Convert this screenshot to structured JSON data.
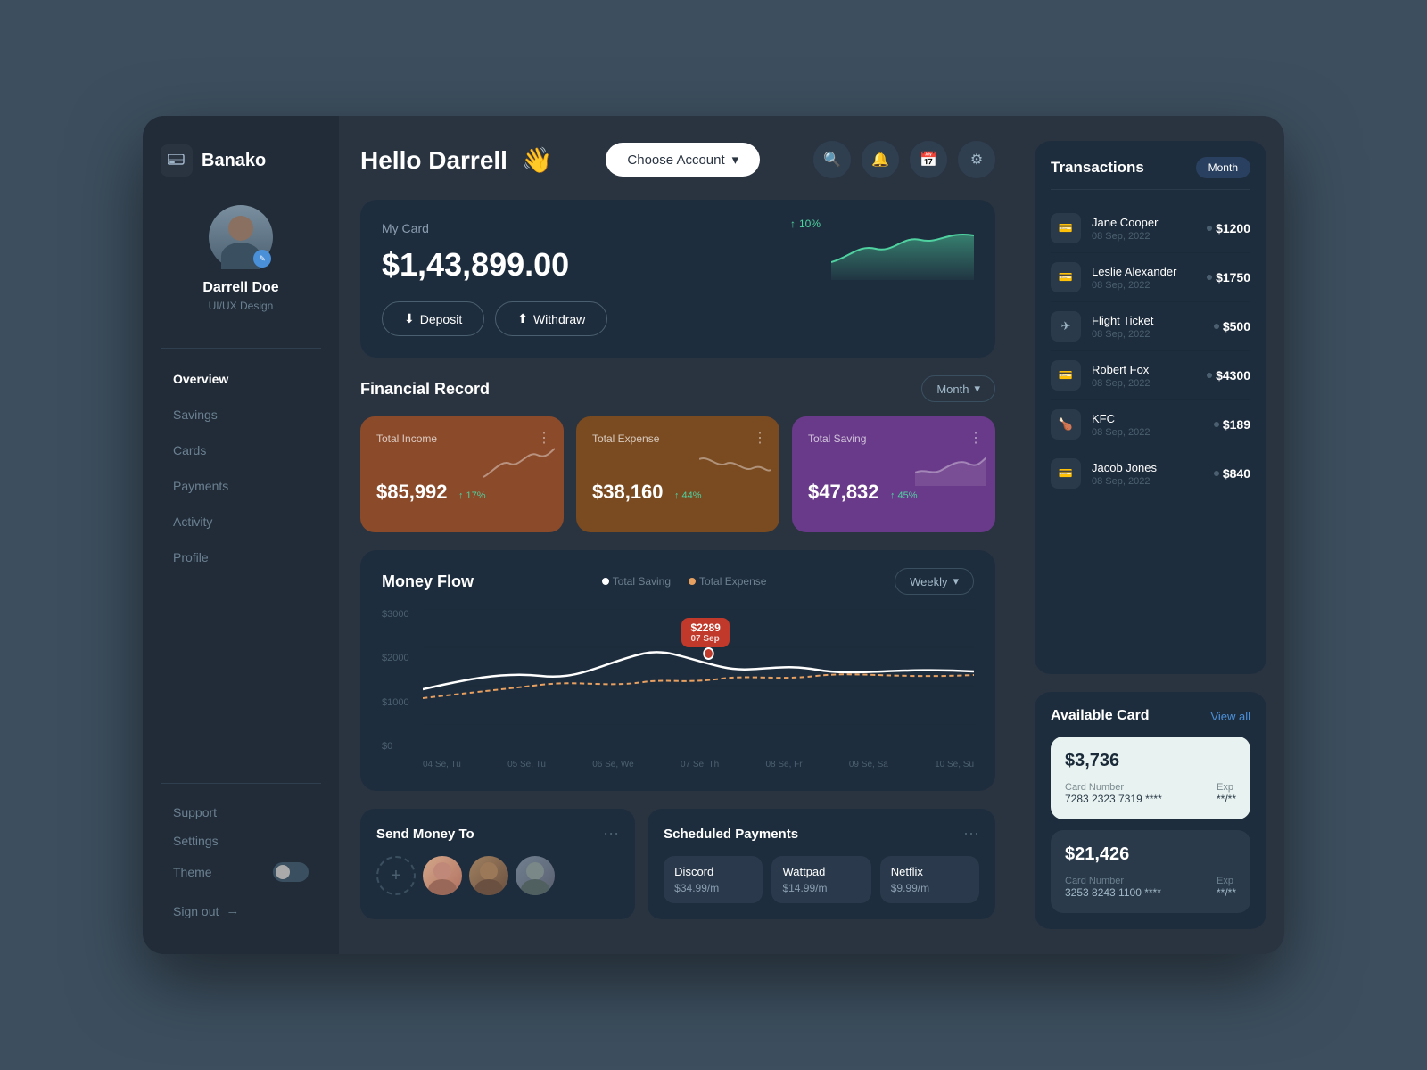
{
  "app": {
    "name": "Banako"
  },
  "user": {
    "name": "Darrell Doe",
    "role": "UI/UX Design",
    "greeting": "Hello Darrell",
    "wave": "👋"
  },
  "header": {
    "choose_account": "Choose Account",
    "actions": [
      "search",
      "bell",
      "calendar",
      "gear"
    ]
  },
  "my_card": {
    "title": "My Card",
    "balance": "$1,43,899.00",
    "trend_pct": "10%",
    "deposit_label": "Deposit",
    "withdraw_label": "Withdraw"
  },
  "financial_record": {
    "title": "Financial Record",
    "period_label": "Month",
    "income": {
      "label": "Total Income",
      "amount": "$85,992",
      "change": "↑ 17%"
    },
    "expense": {
      "label": "Total Expense",
      "amount": "$38,160",
      "change": "↑ 44%"
    },
    "saving": {
      "label": "Total Saving",
      "amount": "$47,832",
      "change": "↑ 45%"
    }
  },
  "money_flow": {
    "title": "Money Flow",
    "legend_saving": "Total Saving",
    "legend_expense": "Total Expense",
    "period_label": "Weekly",
    "tooltip_amount": "$2289",
    "tooltip_date": "07 Sep",
    "y_labels": [
      "$3000",
      "$2000",
      "$1000",
      "$0"
    ],
    "x_labels": [
      "04 Se, Tu",
      "05 Se, Tu",
      "06 Se, We",
      "07 Se, Th",
      "08 Se, Fr",
      "09 Se, Sa",
      "10 Se, Su"
    ]
  },
  "send_money": {
    "title": "Send Money To",
    "contacts": [
      "person1",
      "person2",
      "person3"
    ]
  },
  "scheduled_payments": {
    "title": "Scheduled Payments",
    "items": [
      {
        "name": "Discord",
        "amount": "$34.99/m"
      },
      {
        "name": "Wattpad",
        "amount": "$14.99/m"
      },
      {
        "name": "Netflix",
        "amount": "$9.99/m"
      }
    ]
  },
  "transactions": {
    "title": "Transactions",
    "period_label": "Month",
    "items": [
      {
        "name": "Jane Cooper",
        "date": "08 Sep, 2022",
        "amount": "$1200"
      },
      {
        "name": "Leslie Alexander",
        "date": "08 Sep, 2022",
        "amount": "$1750"
      },
      {
        "name": "Flight Ticket",
        "date": "08 Sep, 2022",
        "amount": "$500"
      },
      {
        "name": "Robert Fox",
        "date": "08 Sep, 2022",
        "amount": "$4300"
      },
      {
        "name": "KFC",
        "date": "08 Sep, 2022",
        "amount": "$189"
      },
      {
        "name": "Jacob Jones",
        "date": "08 Sep, 2022",
        "amount": "$840"
      }
    ]
  },
  "available_cards": {
    "title": "Available Card",
    "view_all": "View all",
    "cards": [
      {
        "balance": "$3,736",
        "card_number_label": "Card Number",
        "card_number": "7283 2323 7319 ****",
        "exp_label": "Exp",
        "exp": "**/**",
        "style": "light"
      },
      {
        "balance": "$21,426",
        "card_number_label": "Card Number",
        "card_number": "3253 8243 1100 ****",
        "exp_label": "Exp",
        "exp": "**/**",
        "style": "dark"
      }
    ]
  },
  "sidebar": {
    "nav_items": [
      {
        "label": "Overview",
        "active": true
      },
      {
        "label": "Savings",
        "active": false
      },
      {
        "label": "Cards",
        "active": false
      },
      {
        "label": "Payments",
        "active": false
      },
      {
        "label": "Activity",
        "active": false
      },
      {
        "label": "Profile",
        "active": false
      }
    ],
    "support_label": "Support",
    "settings_label": "Settings",
    "theme_label": "Theme",
    "signout_label": "Sign out"
  }
}
